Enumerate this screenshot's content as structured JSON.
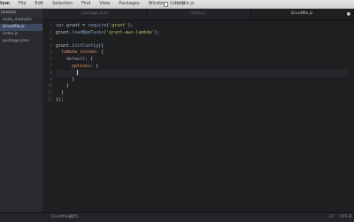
{
  "menubar": {
    "items": [
      "tom",
      "File",
      "Edit",
      "Selection",
      "Find",
      "View",
      "Packages",
      "Window",
      "Help"
    ]
  },
  "window": {
    "title": "Gruntfile.js"
  },
  "sidebar": {
    "root": "lambda",
    "items": [
      "node_modules",
      "Gruntfile.js",
      "index.js",
      "package.json"
    ],
    "selected": 1
  },
  "tabs": [
    "package.json",
    "index.js",
    "Gruntfile.js"
  ],
  "active_tab": 2,
  "editor": {
    "line_numbers": [
      "1",
      "2",
      "3",
      "4",
      "5",
      "6",
      "7",
      "8",
      "9",
      "10",
      "11",
      "12"
    ],
    "current_line": 8,
    "lines": [
      [
        {
          "t": "var ",
          "c": "kw"
        },
        {
          "t": "grunt = ",
          "c": "punc"
        },
        {
          "t": "require",
          "c": "fn"
        },
        {
          "t": "(",
          "c": "punc"
        },
        {
          "t": "'grunt'",
          "c": "str"
        },
        {
          "t": ");",
          "c": "punc"
        }
      ],
      [
        {
          "t": "grunt.",
          "c": "punc"
        },
        {
          "t": "loadNpmTasks",
          "c": "fn"
        },
        {
          "t": "(",
          "c": "punc"
        },
        {
          "t": "'grunt-aws-lambda'",
          "c": "str"
        },
        {
          "t": ");",
          "c": "punc"
        }
      ],
      [],
      [
        {
          "t": "grunt.",
          "c": "punc"
        },
        {
          "t": "initConfig",
          "c": "fn"
        },
        {
          "t": "({",
          "c": "punc"
        }
      ],
      [
        {
          "t": "  lambda_invoke",
          "c": "prop"
        },
        {
          "t": ": {",
          "c": "punc"
        }
      ],
      [
        {
          "t": "    default",
          "c": "kw"
        },
        {
          "t": ": {",
          "c": "punc"
        }
      ],
      [
        {
          "t": "      options",
          "c": "prop"
        },
        {
          "t": ": {",
          "c": "punc"
        }
      ],
      [
        {
          "t": "        ",
          "c": "punc"
        }
      ],
      [
        {
          "t": "      }",
          "c": "punc"
        }
      ],
      [
        {
          "t": "    }",
          "c": "punc"
        }
      ],
      [
        {
          "t": "  }",
          "c": "punc"
        }
      ],
      [
        {
          "t": "});",
          "c": "punc"
        }
      ]
    ]
  },
  "status": {
    "file": "Gruntfile.js*",
    "position": "8:15",
    "eol": "LF",
    "encoding": "UTF-8"
  },
  "colors": {
    "background": "#1d1f21",
    "keyword": "#b294bb",
    "string": "#b5bd68",
    "function": "#81a2be",
    "property": "#de935f",
    "selection": "#3a4a60"
  }
}
